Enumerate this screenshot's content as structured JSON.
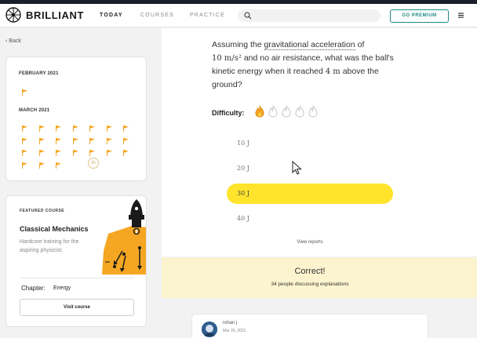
{
  "header": {
    "brand": "BRILLIANT",
    "nav": [
      "TODAY",
      "COURSES",
      "PRACTICE"
    ],
    "search_placeholder": "",
    "premium_label": "GO PREMIUM",
    "accent_color": "#1f8a86"
  },
  "sidebar": {
    "back_label": "Back",
    "calendar": {
      "months": [
        {
          "label": "FEBRUARY 2021",
          "flags": 1
        },
        {
          "label": "MARCH 2021",
          "flags": 24,
          "today_label": "25"
        }
      ],
      "flag_color": "#f5a623"
    },
    "course": {
      "featured_label": "FEATURED COURSE",
      "title": "Classical Mechanics",
      "description": "Hardcore training for the aspiring physicist.",
      "chapter_label": "Chapter:",
      "chapter_value": "Energy",
      "visit_label": "Visit course"
    }
  },
  "question": {
    "text_before": "Assuming the ",
    "term": "gravitational acceleration",
    "text_of": " of",
    "g_value": "10 m/s²",
    "text_middle": " and no air resistance, what was the ball's kinetic energy when it reached ",
    "height_value": "4 m",
    "text_end": " above the ground?",
    "difficulty_label": "Difficulty:",
    "difficulty_level": 1,
    "difficulty_max": 5,
    "answers": [
      "10 J",
      "20 J",
      "30 J",
      "40 J"
    ],
    "selected_answer": "30 J",
    "view_reports_label": "View reports",
    "highlight_color": "#ffe42b"
  },
  "result": {
    "title": "Correct!",
    "subtitle": "34 people discussing explanations"
  },
  "comment": {
    "user": "rohan j",
    "date": "Mar 26, 2021"
  }
}
